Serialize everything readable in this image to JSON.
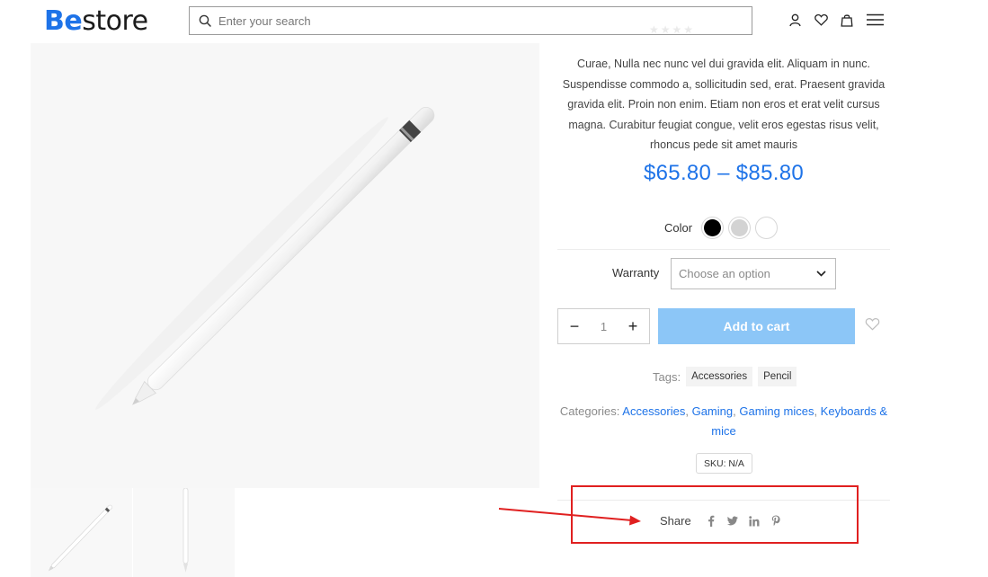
{
  "header": {
    "logo_be": "Be",
    "logo_rest": "store",
    "search_placeholder": "Enter your search",
    "icons": [
      "user-icon",
      "heart-icon",
      "bag-icon",
      "menu-icon"
    ]
  },
  "gallery": {
    "main_image": "apple-pencil-image",
    "thumbnails": [
      "pencil-angled-thumbnail",
      "pencil-vertical-thumbnail"
    ]
  },
  "product": {
    "description": "Curae, Nulla nec nunc vel dui gravida elit. Aliquam in nunc. Suspendisse commodo a, sollicitudin sed, erat. Praesent gravida gravida elit. Proin non enim. Etiam non eros et erat velit cursus magna. Curabitur feugiat congue, velit eros egestas risus velit, rhoncus pede sit amet mauris",
    "price": "$65.80 – $85.80",
    "color_label": "Color",
    "colors": [
      "#000000",
      "#d3d3d3",
      "#ffffff"
    ],
    "warranty_label": "Warranty",
    "warranty_select": "Choose an option",
    "quantity": "1",
    "qty_minus": "−",
    "qty_plus": "+",
    "add_to_cart": "Add to cart",
    "tags_label": "Tags:",
    "tags": [
      "Accessories",
      "Pencil"
    ],
    "categories_label": "Categories:",
    "categories": [
      "Accessories",
      "Gaming",
      "Gaming mices",
      "Keyboards & mice"
    ],
    "sku": "SKU: N/A",
    "share_label": "Share",
    "share_icons": [
      "facebook-icon",
      "twitter-icon",
      "linkedin-icon",
      "pinterest-icon"
    ]
  },
  "accent_color": "#1e73e8",
  "annotation_color": "#e02020"
}
